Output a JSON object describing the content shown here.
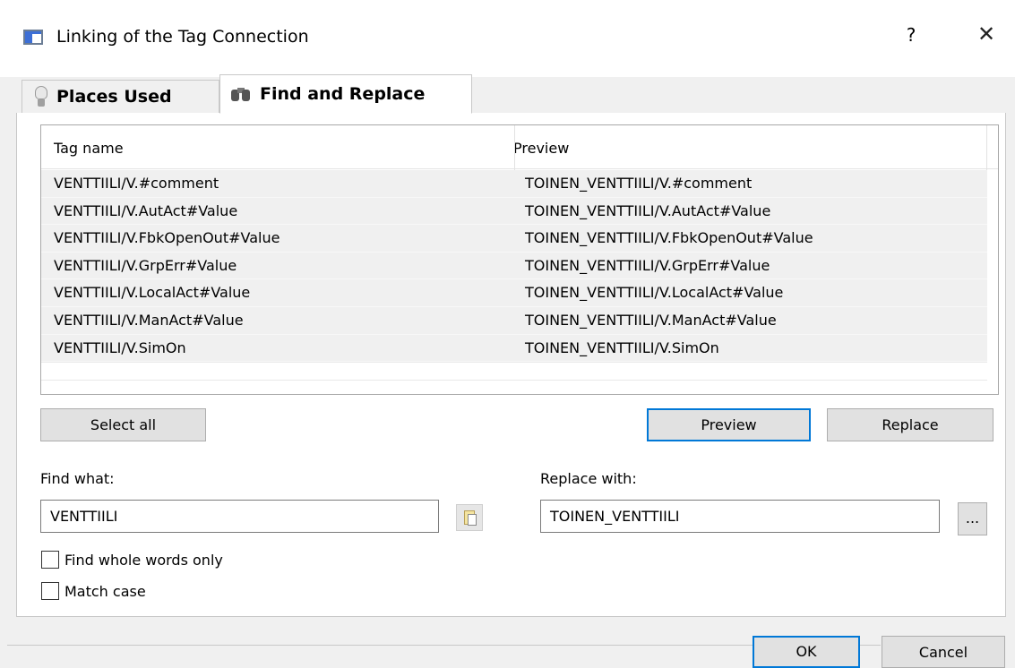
{
  "window": {
    "title": "Linking of the Tag Connection",
    "help_label": "?",
    "close_label": "✕"
  },
  "tabs": [
    {
      "label": "Places Used",
      "icon": "light-bulb-icon",
      "active": false
    },
    {
      "label": "Find and Replace",
      "icon": "binoculars-icon",
      "active": true
    }
  ],
  "table": {
    "columns": [
      "Tag name",
      "Preview"
    ],
    "rows": [
      [
        "VENTTIILI/V.#comment",
        "TOINEN_VENTTIILI/V.#comment"
      ],
      [
        "VENTTIILI/V.AutAct#Value",
        "TOINEN_VENTTIILI/V.AutAct#Value"
      ],
      [
        "VENTTIILI/V.FbkOpenOut#Value",
        "TOINEN_VENTTIILI/V.FbkOpenOut#Value"
      ],
      [
        "VENTTIILI/V.GrpErr#Value",
        "TOINEN_VENTTIILI/V.GrpErr#Value"
      ],
      [
        "VENTTIILI/V.LocalAct#Value",
        "TOINEN_VENTTIILI/V.LocalAct#Value"
      ],
      [
        "VENTTIILI/V.ManAct#Value",
        "TOINEN_VENTTIILI/V.ManAct#Value"
      ],
      [
        "VENTTIILI/V.SimOn",
        "TOINEN_VENTTIILI/V.SimOn"
      ]
    ]
  },
  "buttons": {
    "select_all": "Select all",
    "preview": "Preview",
    "replace": "Replace",
    "browse": "...",
    "ok": "OK",
    "cancel": "Cancel"
  },
  "find": {
    "label": "Find what:",
    "value": "VENTTIILI"
  },
  "replace": {
    "label": "Replace with:",
    "value": "TOINEN_VENTTIILI"
  },
  "options": {
    "whole_words_label": "Find whole words only",
    "whole_words_checked": false,
    "match_case_label": "Match case",
    "match_case_checked": false
  },
  "colors": {
    "accent": "#0078d7",
    "button_face": "#e1e1e1",
    "row_bg": "#f0f0f0"
  }
}
